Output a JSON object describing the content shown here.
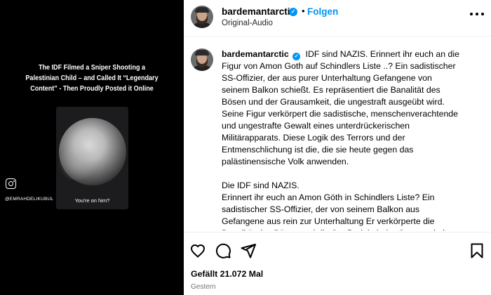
{
  "media": {
    "headline": "The IDF Filmed a Sniper Shooting a Palestinian Child – and Called It “Legendary Content” - Then Proudly Posted it Online",
    "video_caption": "You're on him?",
    "watermark_icon": "instagram-icon",
    "watermark_handle": "@EMRAHDELIKUBUL"
  },
  "header": {
    "username": "bardemantarctic",
    "separator": "•",
    "follow_label": "Folgen",
    "subtitle": "Original-Audio",
    "verified_mark": "✓",
    "more_icon": "more-horizontal-icon"
  },
  "caption": {
    "username": "bardemantarctic",
    "verified_mark": "✓",
    "first_line": "IDF sind NAZIS. Erinnert ihr euch an die Figur von Amon Goth auf Schindlers Liste ..? Ein sadistischer SS-Offizier, der aus purer Unterhaltung Gefangene von seinem Balkon schießt. Es repräsentiert die Banalität des Bösen und der Grausamkeit, die ungestraft ausgeübt wird. Seine Figur verkörpert die sadistische, menschenverachtende und ungestrafte Gewalt eines unterdrückerischen Militärapparats. Diese Logik des Terrors und der Entmenschlichung ist die, die sie heute gegen das palästinensische Volk anwenden.",
    "second_title": "Die IDF sind NAZIS.",
    "second_body": "Erinnert ihr euch an Amon Göth in Schindlers Liste? Ein sadistischer SS-Offizier, der von seinem Balkon aus Gefangene aus rein zur Unterhaltung Er verkörperte die Banalität des Bösen und die Straflosigkeit der Grausamkeit innerhalb eines repressiven Militärapparates."
  },
  "actions": {
    "like_icon": "heart-icon",
    "comment_icon": "comment-icon",
    "share_icon": "share-icon",
    "save_icon": "bookmark-icon",
    "likes_text": "Gefällt 21.072 Mal",
    "date_text": "Gestern"
  }
}
